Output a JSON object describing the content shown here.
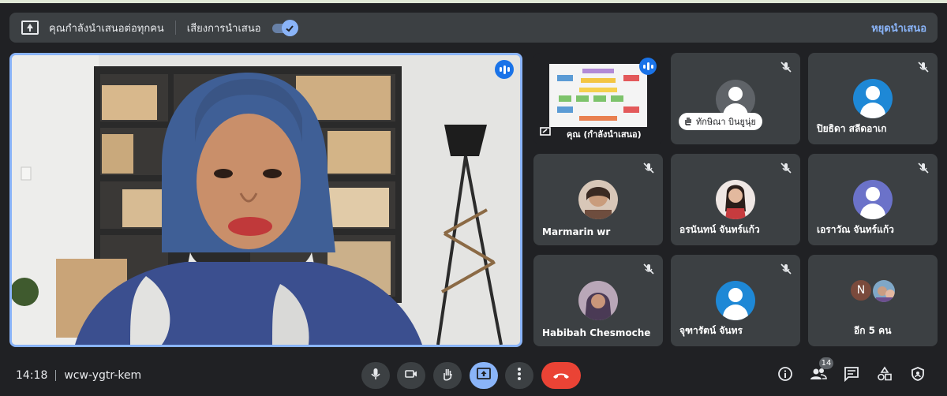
{
  "banner": {
    "presenting_text": "คุณกำลังนำเสนอต่อทุกคน",
    "audio_label": "เสียงการนำเสนอ",
    "stop_label": "หยุดนำเสนอ"
  },
  "tiles": {
    "you": {
      "name": "คุณ (กำลังนำเสนอ)"
    },
    "hand_raise": {
      "name": "ทักษิณา บินยูนุ่ย"
    },
    "p2": {
      "name": "ปิยธิดา สลีดอาเก"
    },
    "p3": {
      "name": "Marmarin wr"
    },
    "p4": {
      "name": "อรนันทน์ จันทร์แก้ว"
    },
    "p5": {
      "name": "เอราวัณ จันทร์แก้ว"
    },
    "p6": {
      "name": "Habibah Chesmoche"
    },
    "p7": {
      "name": "จุฑารัตน์ จันทร"
    },
    "others": {
      "initial": "N",
      "label": "อีก 5 คน"
    }
  },
  "meeting": {
    "time": "14:18",
    "code": "wcw-ygtr-kem"
  },
  "participants_count": "14",
  "colors": {
    "accent": "#8ab4f8",
    "end_call": "#ea4335",
    "tile_bg": "#3c4043",
    "background": "#202124"
  },
  "icons": [
    "present-icon",
    "speaking-icon",
    "mic-off-icon",
    "hand-icon",
    "mic-icon",
    "camera-icon",
    "present-screen-icon",
    "more-icon",
    "end-call-icon",
    "info-icon",
    "people-icon",
    "chat-icon",
    "activities-icon",
    "host-controls-icon"
  ]
}
